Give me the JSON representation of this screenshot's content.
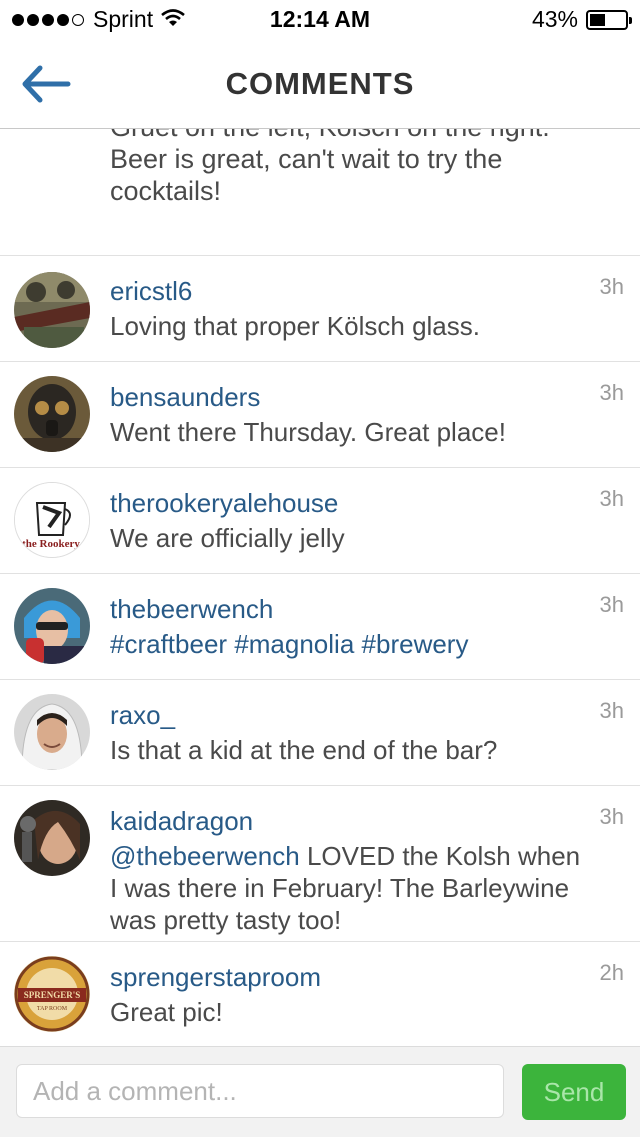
{
  "status_bar": {
    "carrier": "Sprint",
    "time": "12:14 AM",
    "battery_label": "43%",
    "battery_level": 0.43,
    "signal_bars_filled": 4,
    "signal_bars_total": 5
  },
  "nav": {
    "title": "COMMENTS",
    "back_icon": "back-arrow-icon"
  },
  "partial_comment": {
    "text": "Gruet on the left, Kolsch on the right. Beer is great, can't wait to try the cocktails!"
  },
  "comments": [
    {
      "username": "ericstl6",
      "text": "Loving that proper Kölsch glass.",
      "time": "3h"
    },
    {
      "username": "bensaunders",
      "text": "Went there Thursday. Great place!",
      "time": "3h"
    },
    {
      "username": "therookeryalehouse",
      "text": "We are officially jelly",
      "time": "3h"
    },
    {
      "username": "thebeerwench",
      "tags": [
        "#craftbeer",
        "#magnolia",
        "#brewery"
      ],
      "time": "3h"
    },
    {
      "username": "raxo_",
      "text": "Is that a kid at the end of the bar?",
      "time": "3h"
    },
    {
      "username": "kaidadragon",
      "mention": "@thebeerwench",
      "text": " LOVED the Kolsh when I was there in February! The Barleywine was pretty tasty too!",
      "time": "3h"
    },
    {
      "username": "sprengerstaproom",
      "text": "Great pic!",
      "time": "2h"
    }
  ],
  "avatar_text": {
    "rookery": "the Rookery",
    "sprengers": "SPRENGER'S",
    "sprengers_sub": "TAP ROOM"
  },
  "composer": {
    "placeholder": "Add a comment...",
    "send_label": "Send"
  },
  "colors": {
    "link": "#285a87",
    "send_button": "#3cb43c",
    "send_text": "#a9e6a9",
    "nav_back": "#2f6fa8"
  }
}
